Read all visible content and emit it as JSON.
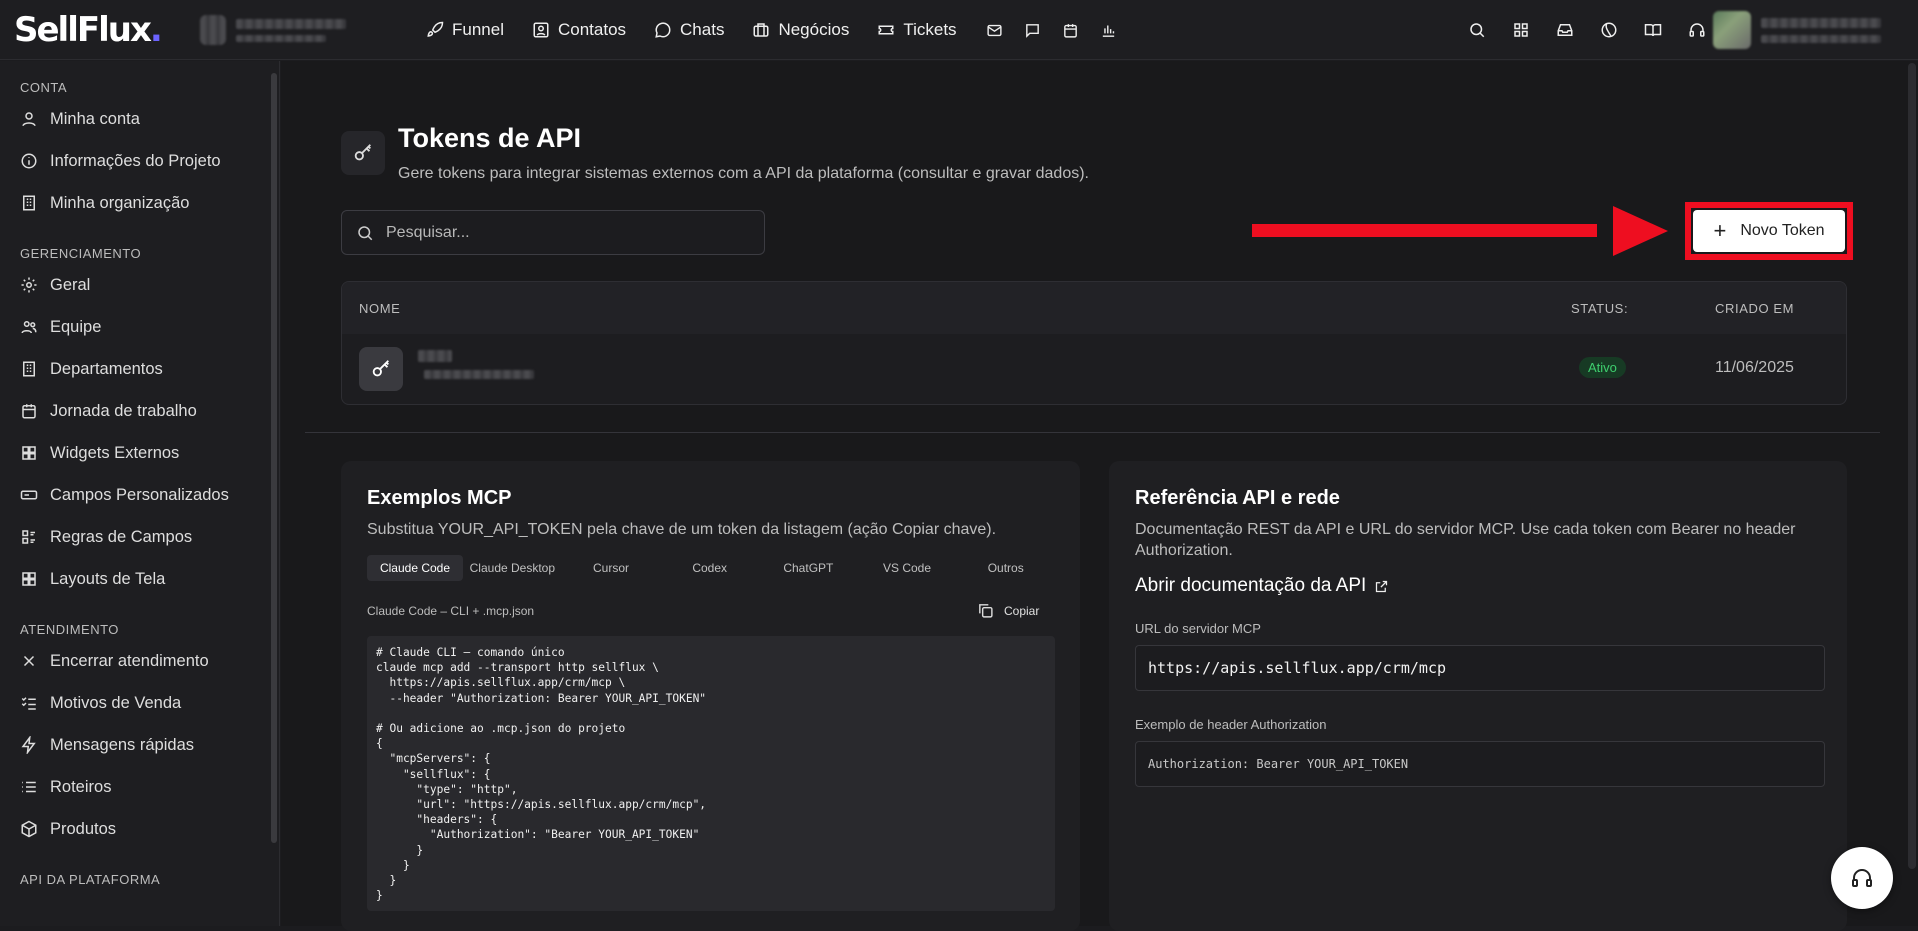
{
  "app": {
    "logo_text": "SellFlux",
    "logo_dot": "."
  },
  "nav": {
    "items": [
      {
        "label": "Funnel",
        "icon": "rocket-icon"
      },
      {
        "label": "Contatos",
        "icon": "contact-card-icon"
      },
      {
        "label": "Chats",
        "icon": "chat-bubble-icon"
      },
      {
        "label": "Negócios",
        "icon": "briefcase-icon"
      },
      {
        "label": "Tickets",
        "icon": "ticket-icon"
      }
    ],
    "extra_icons": [
      "mail-icon",
      "message-square-icon",
      "calendar-icon",
      "bar-chart-icon"
    ]
  },
  "topbar_right_icons": [
    "search-icon",
    "grid-icon",
    "inbox-icon",
    "planet-icon",
    "book-open-icon",
    "headset-icon"
  ],
  "sidebar": {
    "sections": [
      {
        "title": "CONTA",
        "items": [
          {
            "label": "Minha conta",
            "icon": "user-icon"
          },
          {
            "label": "Informações do Projeto",
            "icon": "info-icon"
          },
          {
            "label": "Minha organização",
            "icon": "building-icon"
          }
        ]
      },
      {
        "title": "GERENCIAMENTO",
        "items": [
          {
            "label": "Geral",
            "icon": "gear-icon"
          },
          {
            "label": "Equipe",
            "icon": "users-icon"
          },
          {
            "label": "Departamentos",
            "icon": "building-icon"
          },
          {
            "label": "Jornada de trabalho",
            "icon": "calendar-icon"
          },
          {
            "label": "Widgets Externos",
            "icon": "widgets-icon"
          },
          {
            "label": "Campos Personalizados",
            "icon": "text-field-icon"
          },
          {
            "label": "Regras de Campos",
            "icon": "rules-icon"
          },
          {
            "label": "Layouts de Tela",
            "icon": "layout-icon"
          }
        ]
      },
      {
        "title": "ATENDIMENTO",
        "items": [
          {
            "label": "Encerrar atendimento",
            "icon": "x-icon"
          },
          {
            "label": "Motivos de Venda",
            "icon": "checklist-icon"
          },
          {
            "label": "Mensagens rápidas",
            "icon": "lightning-icon"
          },
          {
            "label": "Roteiros",
            "icon": "list-icon"
          },
          {
            "label": "Produtos",
            "icon": "box-icon"
          }
        ]
      },
      {
        "title": "API DA PLATAFORMA",
        "items": []
      }
    ]
  },
  "page": {
    "title": "Tokens de API",
    "subtitle": "Gere tokens para integrar sistemas externos com a API da plataforma (consultar e gravar dados).",
    "search_placeholder": "Pesquisar...",
    "new_token_label": "Novo Token"
  },
  "table": {
    "columns": {
      "name": "NOME",
      "status": "STATUS:",
      "created": "CRIADO EM"
    },
    "rows": [
      {
        "status": "Ativo",
        "created": "11/06/2025"
      }
    ]
  },
  "mcp_card": {
    "title": "Exemplos MCP",
    "description": "Substitua YOUR_API_TOKEN pela chave de um token da listagem (ação Copiar chave).",
    "tabs": [
      "Claude Code",
      "Claude Desktop",
      "Cursor",
      "Codex",
      "ChatGPT",
      "VS Code",
      "Outros"
    ],
    "active_tab": "Claude Code",
    "code_label": "Claude Code – CLI + .mcp.json",
    "copy_label": "Copiar",
    "code": "# Claude CLI — comando único\nclaude mcp add --transport http sellflux \\\n  https://apis.sellflux.app/crm/mcp \\\n  --header \"Authorization: Bearer YOUR_API_TOKEN\"\n\n# Ou adicione ao .mcp.json do projeto\n{\n  \"mcpServers\": {\n    \"sellflux\": {\n      \"type\": \"http\",\n      \"url\": \"https://apis.sellflux.app/crm/mcp\",\n      \"headers\": {\n        \"Authorization\": \"Bearer YOUR_API_TOKEN\"\n      }\n    }\n  }\n}"
  },
  "api_card": {
    "title": "Referência API e rede",
    "description": "Documentação REST da API e URL do servidor MCP. Use cada token com Bearer no header Authorization.",
    "doc_link": "Abrir documentação da API",
    "mcp_url_label": "URL do servidor MCP",
    "mcp_url": "https://apis.sellflux.app/crm/mcp",
    "header_label": "Exemplo de header Authorization",
    "header_example": "Authorization: Bearer YOUR_API_TOKEN"
  },
  "colors": {
    "accent": "#6c63ff",
    "highlight_red": "#ee0e20",
    "status_green": "#3ecf6e"
  }
}
